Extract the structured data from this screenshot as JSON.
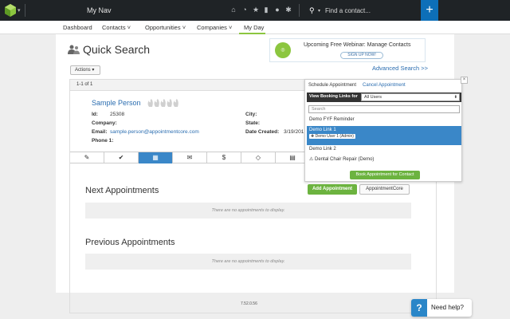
{
  "topbar": {
    "nav_title": "My Nav",
    "search_placeholder": "Find a contact...",
    "plus_label": "+"
  },
  "mainnav": {
    "items": [
      {
        "label": "Dashboard"
      },
      {
        "label": "Contacts ˅"
      },
      {
        "label": "Opportunities ˅"
      },
      {
        "label": "Companies ˅"
      },
      {
        "label": "My Day"
      }
    ]
  },
  "page": {
    "title": "Quick Search",
    "webinar_title": "Upcoming Free Webinar: Manage Contacts",
    "webinar_button": "SIGN UP NOW!",
    "actions_label": "Actions ▾",
    "advanced_search": "Advanced Search >>",
    "result_count": "1-1 of 1"
  },
  "contact": {
    "name": "Sample Person",
    "id_label": "Id:",
    "id_value": "25308",
    "company_label": "Company:",
    "email_label": "Email:",
    "email_value": "sample.person@appointmentcore.com",
    "phone_label": "Phone 1:",
    "city_label": "City:",
    "state_label": "State:",
    "date_created_label": "Date Created:",
    "date_created_value": "3/19/201"
  },
  "tabs": [
    {
      "icon": "edit-icon",
      "glyph": "✎"
    },
    {
      "icon": "check-icon",
      "glyph": "✔"
    },
    {
      "icon": "calendar-icon",
      "glyph": "▦"
    },
    {
      "icon": "mail-icon",
      "glyph": "✉"
    },
    {
      "icon": "dollar-icon",
      "glyph": "$"
    },
    {
      "icon": "tag-icon",
      "glyph": "◇"
    },
    {
      "icon": "notes-icon",
      "glyph": "▤"
    }
  ],
  "appointments": {
    "next_title": "Next Appointments",
    "add_button": "Add Appointment",
    "core_button": "AppointmentCore",
    "next_empty": "There are no appointments to display.",
    "previous_title": "Previous Appointments",
    "previous_empty": "There are no appointments to display."
  },
  "panel": {
    "schedule_label": "Schedule Appointment",
    "cancel_label": "Cancel Appointment",
    "view_booking_label": "View Booking Links for",
    "view_booking_value": "All Users",
    "search_placeholder": "Search",
    "options": [
      {
        "label": "Demo FYF Reminder"
      },
      {
        "label": "Demo Link 1",
        "user": "✚ Demo User 1 (Admin)"
      },
      {
        "label": "Demo Link 2"
      },
      {
        "label": "Dental Chair Repair (Demo)"
      }
    ],
    "book_button": "Book Appointment for Contact",
    "close_label": "×"
  },
  "footer": {
    "version": "7.52.0.56",
    "help_label": "Need help?",
    "help_glyph": "?"
  },
  "colors": {
    "topbar": "#1f2326",
    "accent_blue": "#3a87c8",
    "accent_green": "#6cb33f",
    "link": "#2a6db0"
  }
}
